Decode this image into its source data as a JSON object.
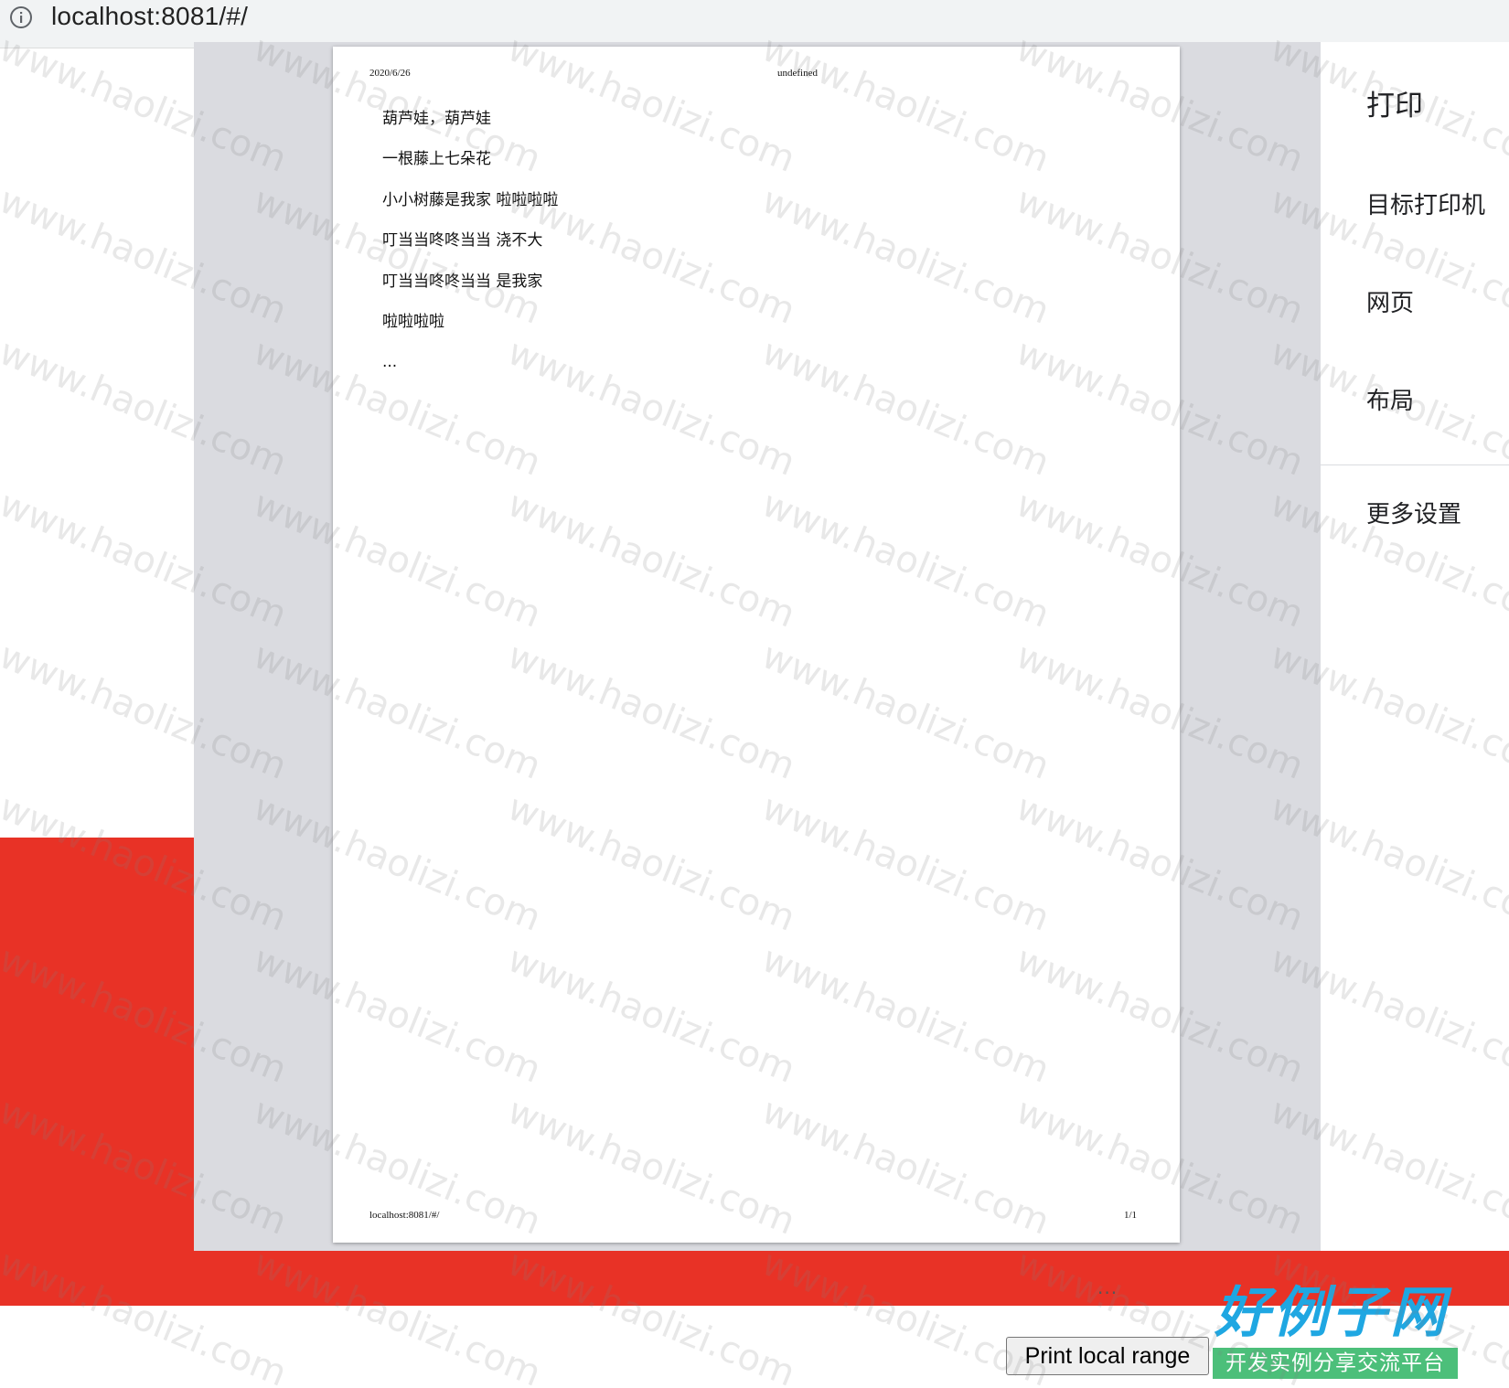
{
  "browser": {
    "url": "localhost:8081/#/"
  },
  "preview": {
    "header_date": "2020/6/26",
    "header_title": "undefined",
    "footer_url": "localhost:8081/#/",
    "footer_page": "1/1",
    "lines": [
      "葫芦娃，葫芦娃",
      "一根藤上七朵花",
      "小小树藤是我家 啦啦啦啦",
      "叮当当咚咚当当 浇不大",
      "叮当当咚咚当当 是我家",
      "啦啦啦啦",
      "..."
    ]
  },
  "sidebar": {
    "title": "打印",
    "destination_label": "目标打印机",
    "pages_label": "网页",
    "layout_label": "布局",
    "more_settings_label": "更多设置"
  },
  "page": {
    "ellipsis": "...",
    "print_button_label": "Print local range"
  },
  "logo": {
    "main_text": "好例子网",
    "tagline": "开发实例分享交流平台"
  },
  "watermark": {
    "text": "www.haolizi.com"
  },
  "colors": {
    "red_band": "#e83226",
    "preview_bg": "#dadbe0",
    "logo_blue": "#1fa7e2",
    "logo_green": "#4cbf7a"
  }
}
